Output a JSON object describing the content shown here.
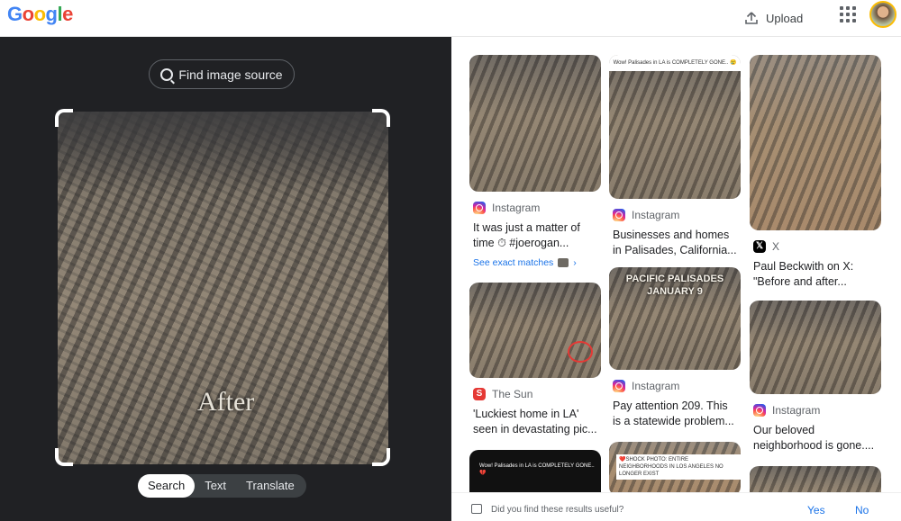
{
  "header": {
    "logo": "Google",
    "upload_label": "Upload",
    "apps_icon": "apps-grid-icon",
    "avatar_icon": "profile-avatar"
  },
  "left": {
    "find_source_label": "Find image source",
    "image_caption": "After",
    "modes": [
      "Search",
      "Text",
      "Translate"
    ],
    "active_mode": "Search"
  },
  "results": {
    "col1": [
      {
        "source": "Instagram",
        "title": "It was just a matter of time ⏱ #joerogan...",
        "exact_matches": "See exact matches"
      },
      {
        "source": "The Sun",
        "title": "'Luckiest home in LA' seen in devastating pic..."
      },
      {
        "thumb_caption": "Wow! Palisades in LA is COMPLETELY GONE.. 💔"
      }
    ],
    "col2": [
      {
        "thumb_caption": "Wow! Palisades in LA is COMPLETELY GONE.. 😢",
        "source": "Instagram",
        "title": "Businesses and homes in Palisades, California..."
      },
      {
        "thumb_overlay": "PACIFIC PALISADES\nJANUARY 9",
        "source": "Instagram",
        "title": "Pay attention 209. This is a statewide problem..."
      },
      {
        "thumb_caption": "❤️SHOCK PHOTO: ENTIRE NEIGHBORHOODS IN LOS ANGELES NO LONGER EXIST"
      }
    ],
    "col3": [
      {
        "source": "X",
        "title": "Paul Beckwith on X: \"Before and after..."
      },
      {
        "source": "Instagram",
        "title": "Our beloved neighborhood is gone...."
      }
    ]
  },
  "footer": {
    "question": "Did you find these results useful?",
    "yes": "Yes",
    "no": "No"
  }
}
